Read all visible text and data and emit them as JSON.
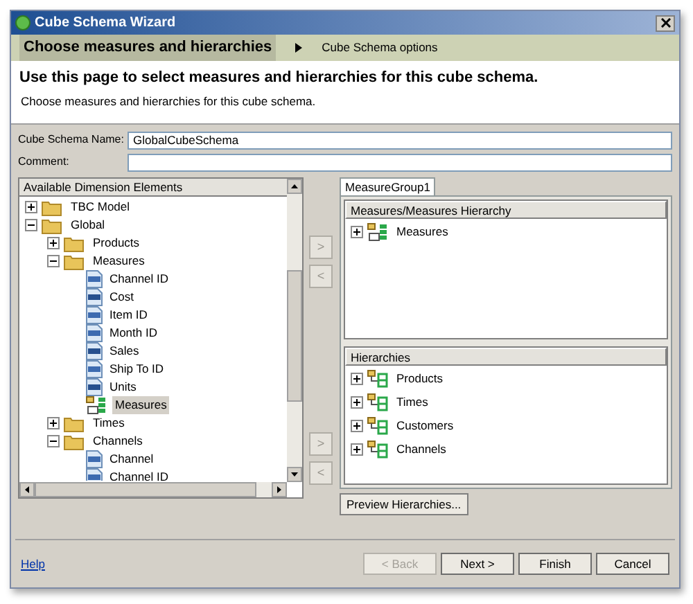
{
  "window": {
    "title": "Cube Schema Wizard"
  },
  "steps": [
    {
      "label": "Choose measures and hierarchies",
      "selected": true
    },
    {
      "label": "Cube Schema options",
      "selected": false
    }
  ],
  "header": {
    "title": "Use this page to select measures and hierarchies for this cube schema.",
    "description": "Choose measures and hierarchies for this cube schema."
  },
  "fields": [
    {
      "label": "Cube Schema Name:",
      "value": "GlobalCubeSchema"
    },
    {
      "label": "Comment:"
    }
  ],
  "available": {
    "heading": "Available Dimension Elements",
    "items": [
      {
        "label": "TBC Model",
        "kind": "folder",
        "expanded": false,
        "selected": false
      },
      {
        "label": "Global",
        "kind": "folder",
        "expanded": true,
        "selected": false,
        "children": [
          {
            "label": "Products",
            "kind": "folder",
            "expanded": false,
            "selected": false
          },
          {
            "label": "Measures",
            "kind": "folder",
            "expanded": true,
            "selected": false,
            "children": [
              {
                "label": "Channel ID",
                "kind": "text",
                "selected": false
              },
              {
                "label": "Cost",
                "kind": "number",
                "selected": false
              },
              {
                "label": "Item ID",
                "kind": "text",
                "selected": false
              },
              {
                "label": "Month ID",
                "kind": "text",
                "selected": false
              },
              {
                "label": "Sales",
                "kind": "number",
                "selected": false
              },
              {
                "label": "Ship To ID",
                "kind": "text",
                "selected": false
              },
              {
                "label": "Units",
                "kind": "number",
                "selected": false
              },
              {
                "label": "Measures",
                "kind": "measure",
                "selected": true
              }
            ]
          },
          {
            "label": "Times",
            "kind": "folder",
            "expanded": false,
            "selected": false
          },
          {
            "label": "Channels",
            "kind": "folder",
            "expanded": true,
            "selected": false,
            "children": [
              {
                "label": "Channel",
                "kind": "text",
                "selected": false
              },
              {
                "label": "Channel ID",
                "kind": "text",
                "selected": false
              }
            ]
          }
        ]
      }
    ]
  },
  "move_buttons": [
    ">",
    "<",
    ">",
    "<"
  ],
  "tab": {
    "label": "MeasureGroup1",
    "selected": true
  },
  "measures_panel": {
    "heading": "Measures/Measures Hierarchy",
    "items": [
      {
        "label": "Measures",
        "kind": "measure",
        "expanded": false
      }
    ]
  },
  "hierarchies_panel": {
    "heading": "Hierarchies",
    "items": [
      {
        "label": "Products",
        "kind": "hierarchy",
        "expanded": false
      },
      {
        "label": "Times",
        "kind": "hierarchy",
        "expanded": false
      },
      {
        "label": "Customers",
        "kind": "hierarchy",
        "expanded": false
      },
      {
        "label": "Channels",
        "kind": "hierarchy",
        "expanded": false
      }
    ]
  },
  "preview_button": "Preview Hierarchies...",
  "help_link": "Help",
  "buttons": [
    {
      "label": "< Back",
      "disabled": true
    },
    {
      "label": "Next >",
      "disabled": false
    },
    {
      "label": "Finish",
      "disabled": false
    },
    {
      "label": "Cancel",
      "disabled": false
    }
  ]
}
